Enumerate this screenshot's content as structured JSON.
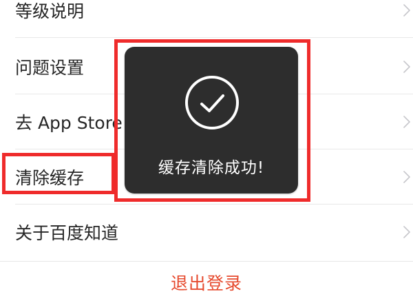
{
  "settings": {
    "items": [
      {
        "label": "等级说明"
      },
      {
        "label": "问题设置"
      },
      {
        "label": "去 App Store 评价"
      },
      {
        "label": "清除缓存"
      },
      {
        "label": "关于百度知道"
      }
    ]
  },
  "logout": {
    "label": "退出登录"
  },
  "toast": {
    "message": "缓存清除成功!",
    "icon": "check-circle-icon"
  },
  "colors": {
    "text": "#262626",
    "logout": "#e64a2e",
    "toast_bg": "#2d2d2d",
    "annotation": "#ef2b2b",
    "chevron": "#c7c7cc"
  }
}
